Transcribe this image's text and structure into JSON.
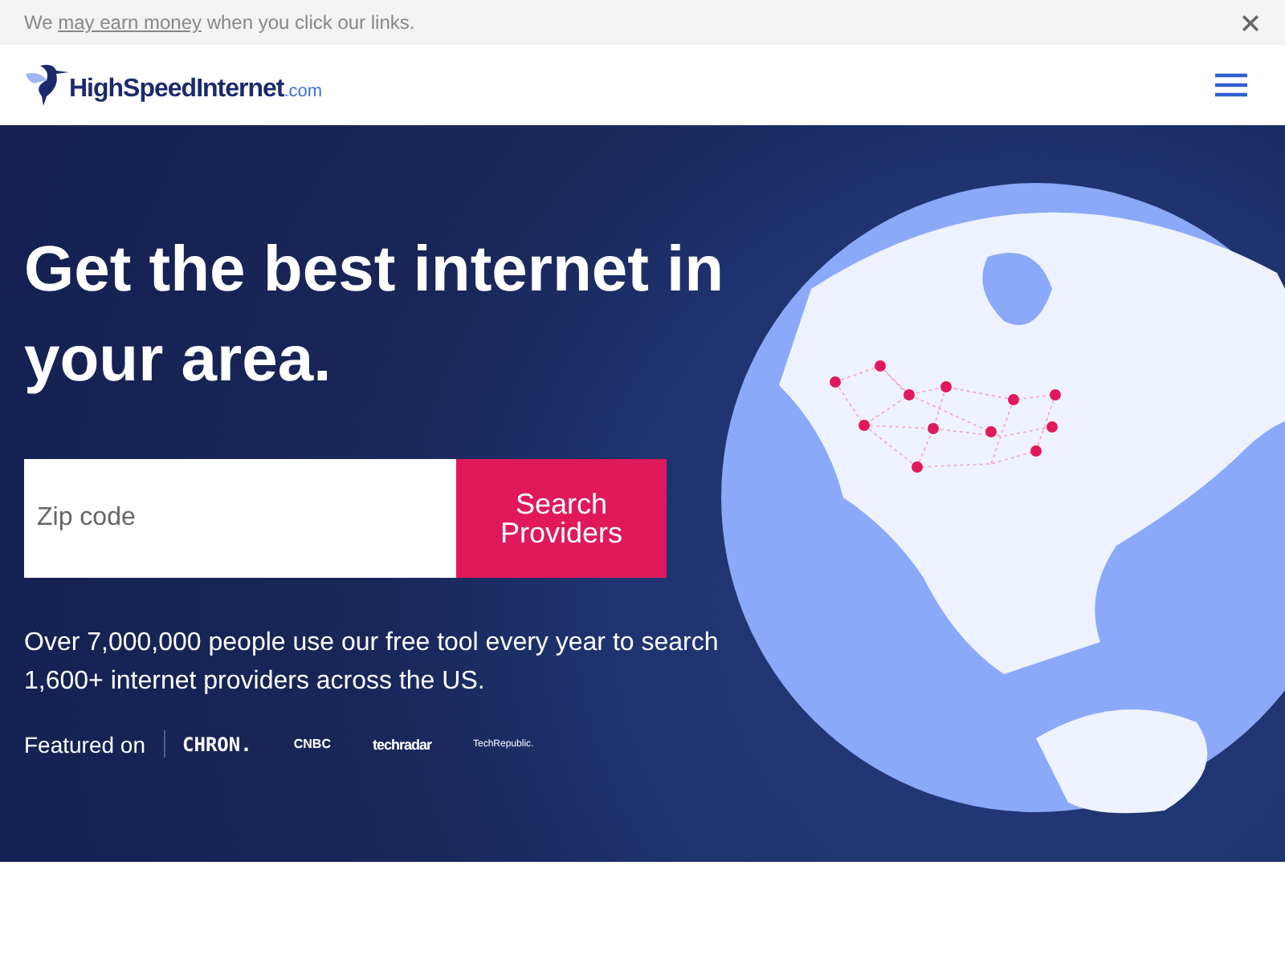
{
  "notice": {
    "link": "may earn money",
    "before": "We ",
    "after": " when you click our links."
  },
  "header": {
    "logo_main": "HighSpeedInternet",
    "logo_suffix": ".com"
  },
  "hero": {
    "heading": "Get the best internet in your area.",
    "search": {
      "placeholder": "Zip code",
      "button": "Search Providers"
    },
    "description": "Over 7,000,000 people use our free tool every year to search 1,600+ internet providers across the US.",
    "featured_label": "Featured on",
    "featured": [
      {
        "kind": "chron",
        "text": "CHRON."
      },
      {
        "kind": "cnbc",
        "text": "CNBC"
      },
      {
        "kind": "techradar",
        "text": "techradar"
      },
      {
        "kind": "techrepublic",
        "text": "TechRepublic."
      }
    ]
  }
}
